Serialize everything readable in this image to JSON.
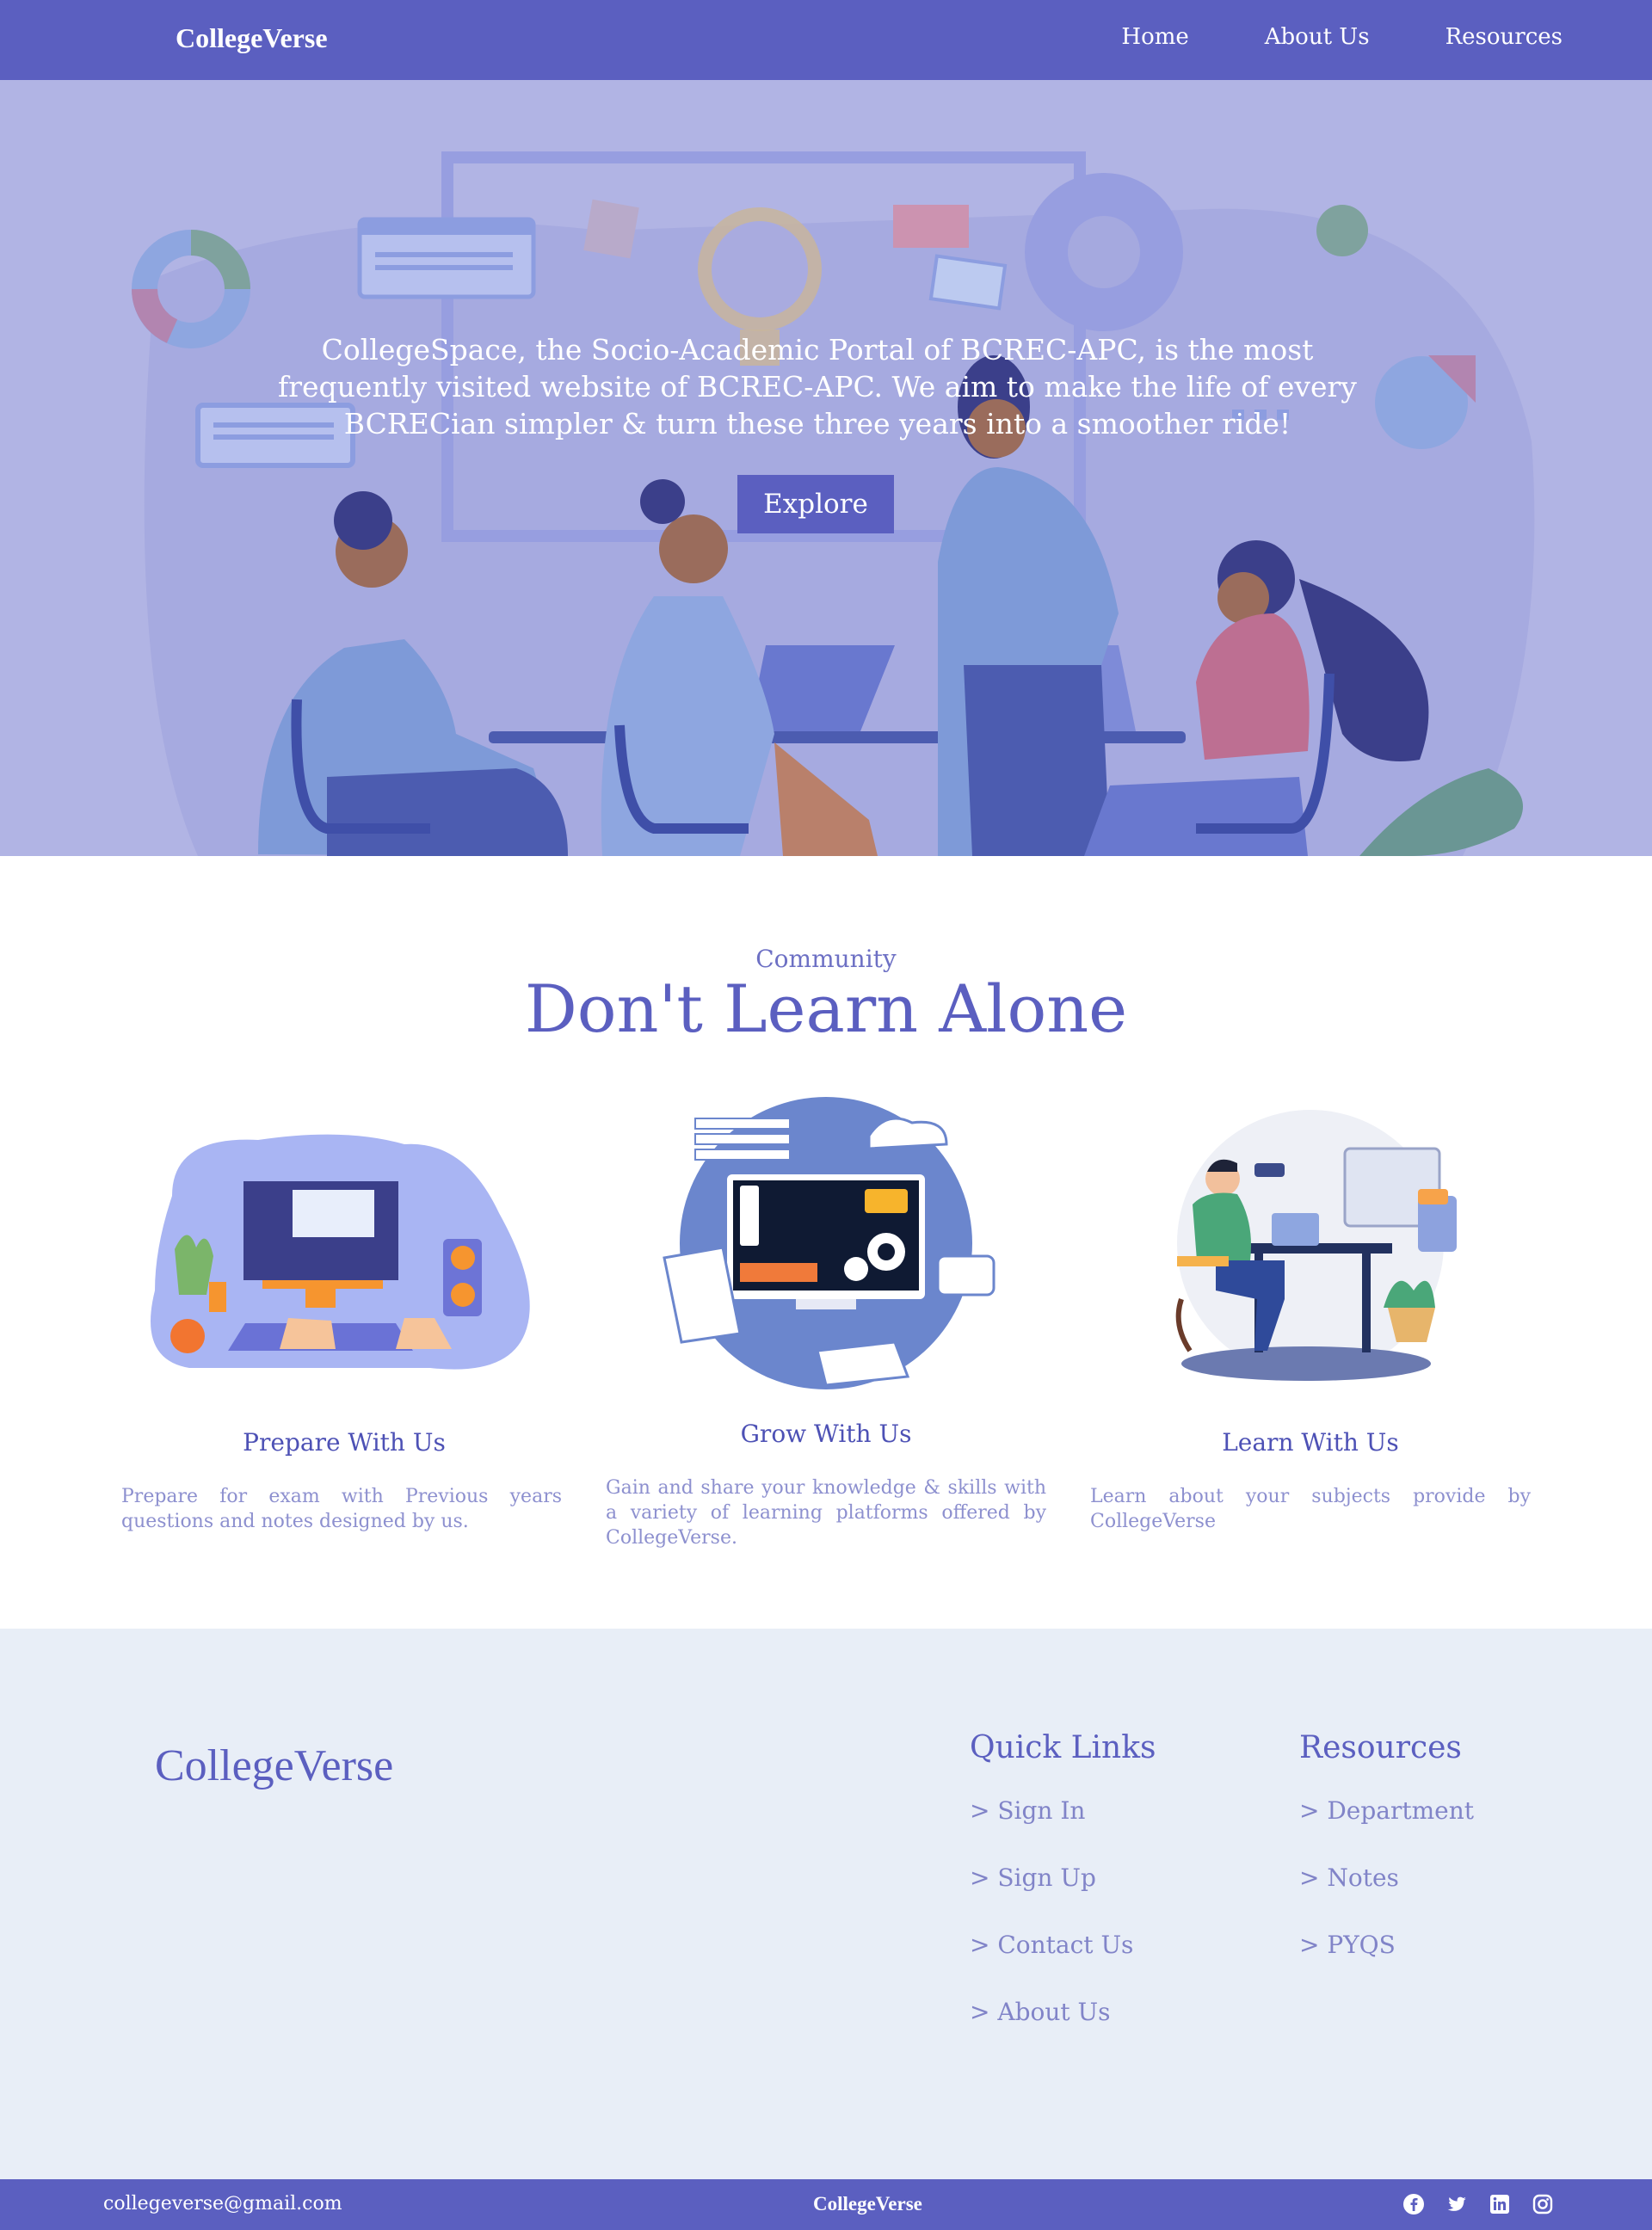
{
  "nav": {
    "brand": "CollegeVerse",
    "links": [
      "Home",
      "About Us",
      "Resources"
    ]
  },
  "hero": {
    "text": "CollegeSpace, the Socio-Academic Portal of BCREC-APC, is the most frequently visited website of BCREC-APC. We aim to make the life of every BCRECian simpler & turn these three years into a smoother ride!",
    "button": "Explore"
  },
  "community": {
    "subtitle": "Community",
    "title": "Don't Learn Alone",
    "features": [
      {
        "title": "Prepare With Us",
        "desc": "Prepare for exam with Previous years questions and notes designed by us."
      },
      {
        "title": "Grow With Us",
        "desc": "Gain and share your knowledge & skills with a variety of learning platforms offered by CollegeVerse."
      },
      {
        "title": "Learn With Us",
        "desc": "Learn about your subjects provide by CollegeVerse"
      }
    ]
  },
  "footer": {
    "brand": "CollegeVerse",
    "quick_links": {
      "heading": "Quick Links",
      "items": [
        "> Sign In",
        "> Sign Up",
        "> Contact Us",
        "> About Us"
      ]
    },
    "resources": {
      "heading": "Resources",
      "items": [
        "> Department",
        "> Notes",
        "> PYQS"
      ]
    }
  },
  "bottom_bar": {
    "email": "collegeverse@gmail.com",
    "brand": "CollegeVerse",
    "socials": [
      "facebook-icon",
      "twitter-icon",
      "linkedin-icon",
      "instagram-icon"
    ]
  },
  "colors": {
    "primary": "#5b5fc0",
    "hero_bg": "#b1b4e4",
    "footer_bg": "#e8eef7",
    "muted_text": "#8d90cf"
  }
}
